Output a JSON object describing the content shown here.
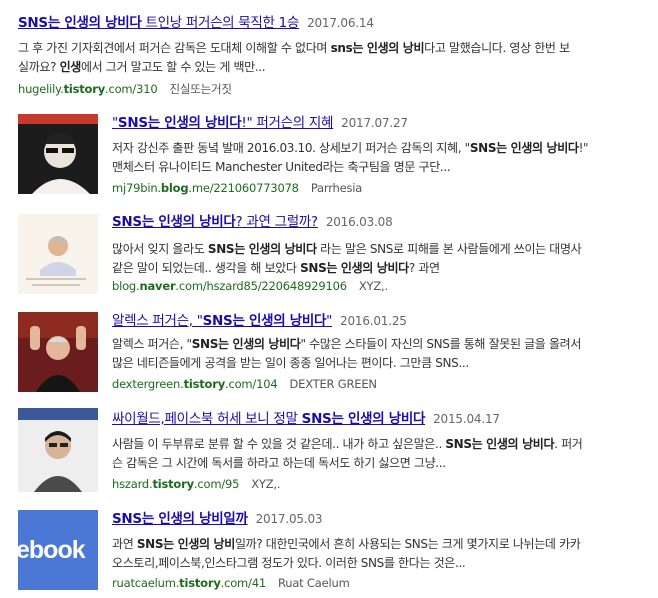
{
  "results": [
    {
      "title_pre": "",
      "title_kw": "SNS는 인생의 낭비다",
      "title_post": " 트인낭 퍼거슨의 묵직한 1승",
      "date": "2017.06.14",
      "snippet_line1_a": "그 후 가진 기자회견에서 퍼거슨 감독은 도대체 이해할 수 없다며 ",
      "snippet_line1_kw": "sns는 인생의 낭비",
      "snippet_line1_b": "다고 말했습니다. 영상 한번 보",
      "snippet_line2_a": "실까요? ",
      "snippet_line2_kw": "인생",
      "snippet_line2_b": "에서 그거 말고도 할 수 있는 게 백만...",
      "url_a": "hugelily.",
      "url_kw": "tistory",
      "url_b": ".com/310",
      "source": "진실또는거짓"
    },
    {
      "title_pre": "\"",
      "title_kw": "SNS는 인생의 낭비다",
      "title_post": "!\" 퍼거슨의 지혜",
      "date": "2017.07.27",
      "snippet_line1_a": "저자 강신주 출판 동녘 발매 2016.03.10. 상세보기 퍼거슨 감독의 지혜, \"",
      "snippet_line1_kw": "SNS는 인생의 낭비다",
      "snippet_line1_b": "!\"",
      "snippet_line2_a": "맨체스터 유나이티드 Manchester United라는 축구팀을 명문 구단...",
      "snippet_line2_kw": "",
      "snippet_line2_b": "",
      "url_a": "mj79bin.",
      "url_kw": "blog",
      "url_b": ".me/221060773078",
      "source": "Parrhesia"
    },
    {
      "title_pre": "",
      "title_kw": "SNS는 인생의 낭비다",
      "title_post": "? 과연 그럴까?",
      "date": "2016.03.08",
      "snippet_line1_a": "많아서 잊지 올라도 ",
      "snippet_line1_kw": "SNS는 인생의 낭비다",
      "snippet_line1_b": " 라는 말은 SNS로 피해를 본 사람들에게 쓰이는 대명사",
      "snippet_line2_a": "같은 말이 되었는데.. 생각을 해 보았다 ",
      "snippet_line2_kw": "SNS는 인생의 낭비다",
      "snippet_line2_b": "? 과연",
      "url_a": "blog.",
      "url_kw": "naver",
      "url_b": ".com/hszard85/220648929106",
      "source": "XYZ,."
    },
    {
      "title_pre": "알렉스 퍼거슨, \"",
      "title_kw": "SNS는 인생의 낭비다",
      "title_post": "\"",
      "date": "2016.01.25",
      "snippet_line1_a": "알렉스 퍼거슨, \"",
      "snippet_line1_kw": "SNS는 인생의 낭비다",
      "snippet_line1_b": "\" 수많은 스타들이 자신의 SNS를 통해 잘못된 글을 올려서",
      "snippet_line2_a": "많은 네티즌들에게 공격을 받는 일이 종종 일어나는 편이다. 그만큼 SNS...",
      "snippet_line2_kw": "",
      "snippet_line2_b": "",
      "url_a": "dextergreen.",
      "url_kw": "tistory",
      "url_b": ".com/104",
      "source": "DEXTER GREEN"
    },
    {
      "title_pre": "싸이월드,페이스북 허세 보니 정말 ",
      "title_kw": "SNS는 인생의 낭비다",
      "title_post": "",
      "date": "2015.04.17",
      "snippet_line1_a": "사람들 이 두부류로 분류 할 수 있을 것 같은데.. 내가 하고 싶은말은.. ",
      "snippet_line1_kw": "SNS는 인생의 낭비다",
      "snippet_line1_b": ". 퍼거",
      "snippet_line2_a": "슨 감독은 그 시간에 독서를 하라고 하는데 독서도 하기 싫으면 그냥...",
      "snippet_line2_kw": "",
      "snippet_line2_b": "",
      "url_a": "hszard.",
      "url_kw": "tistory",
      "url_b": ".com/95",
      "source": "XYZ,."
    },
    {
      "title_pre": "",
      "title_kw": "SNS는 인생의 낭비일까",
      "title_post": "",
      "date": "2017.05.03",
      "snippet_line1_a": "과연 ",
      "snippet_line1_kw": "SNS는 인생의 낭비",
      "snippet_line1_b": "일까? 대한민국에서 흔히 사용되는 SNS는 크게 몇가지로 나뉘는데 카카",
      "snippet_line2_a": "오스토리,페이스북,인스타그램 정도가 있다. 이러한 SNS를 한다는 것은...",
      "snippet_line2_kw": "",
      "snippet_line2_b": "",
      "url_a": "ruatcaelum.",
      "url_kw": "tistory",
      "url_b": ".com/41",
      "source": "Ruat Caelum"
    }
  ],
  "thumbnails": {
    "t4_text": "ebook"
  }
}
